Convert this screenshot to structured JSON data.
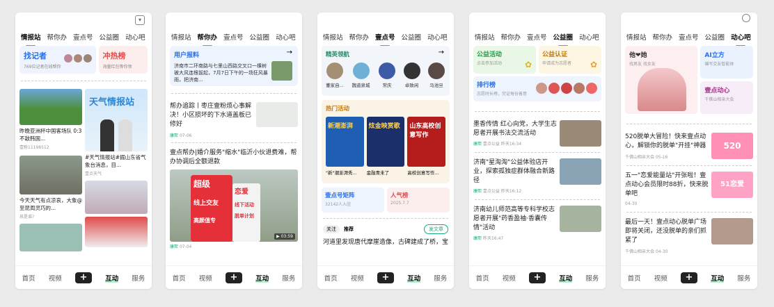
{
  "tabs": [
    "情报站",
    "帮你办",
    "壹点号",
    "公益圈",
    "动心吧"
  ],
  "nav": [
    "首页",
    "视频",
    "+",
    "互动",
    "服务"
  ],
  "s1": {
    "chip1": {
      "title": "找记者",
      "sub": "769位记者在线帮你"
    },
    "chip2": {
      "title": "冲热榜",
      "sub": "海量红包等你领"
    },
    "card1": {
      "title": "昨晚亚洲杯中国客场队 0:3不敌韩国...",
      "author": "壹粉11198512"
    },
    "card2": {
      "banner": "天气情报站",
      "title": "#天气情报站#掘山东省气象台消息，目...",
      "author": "壹点天气"
    },
    "card3": {
      "title": "今天天气有点凉哀，大象@至昆周灵巧的...",
      "author": "孩是谁?"
    }
  },
  "s2": {
    "report": {
      "label": "用户报料",
      "text": "济南市二环南路与七里山西路交叉口一棵树被大风连根拔起，7月7日下午的一场狂风暴雨，把济南..."
    },
    "a1": {
      "title": "帮办追踪丨枣庄壹粉烦心事解决！小区损坏的下水道盖板已修好",
      "source": "康熙",
      "date": "07-06"
    },
    "a2": {
      "title": "壹点帮办|婚介服务\"缩水\"临沂小伙退费难，帮办协调后全额退款",
      "source": "康熙",
      "date": "07-04"
    },
    "a2img": {
      "t1": "超级",
      "t2": "恋爱",
      "t3": "线上交友",
      "t4": "线下活动",
      "t5": "高颜值专",
      "t6": "脱单计划",
      "dur": "03:59"
    }
  },
  "s3": {
    "elite": "精英领航",
    "people": [
      "董家自...",
      "魏道泉城",
      "常庆",
      "卓致闲",
      "马池旦"
    ],
    "hot": "热门活动",
    "acts": [
      {
        "img": "新潮澎湃",
        "cap": "\"新\"潮澎湃秀..."
      },
      {
        "img": "炫金映赏歌",
        "cap": "金融青未了"
      },
      {
        "img": "山东高校创意写作",
        "cap": "高校创意写作..."
      }
    ],
    "matrix": "壹点号矩阵",
    "matrix_sub": "32142人入驻",
    "pop": "人气榜",
    "pop_date": "2025.7.7",
    "follow": "关注",
    "rec": "推荐",
    "post": "发文章",
    "tail": "河道里发现唐代摩崖造像，古碑建成了桥，宝"
  },
  "s4": {
    "c1": {
      "title": "公益活动",
      "sub": "点击参加活动"
    },
    "c2": {
      "title": "公益认证",
      "sub": "申请成为志愿者"
    },
    "rank": "排行榜",
    "rank_sub": "志愿时长榜，完证每份善意",
    "items": [
      {
        "title": "墨香传情 红心向党，大学生志愿者开展书法交流活动",
        "date": "昨天16:34"
      },
      {
        "title": "济南\"星淘淘\"公益体验店开业，探索孤独症群体融合新路径",
        "date": "昨天16:12"
      },
      {
        "title": "济南幼儿师范高等专科学校志愿者开展\"药香盈袖·香囊传情\"活动",
        "date": "昨天16:47"
      }
    ]
  },
  "s5": {
    "heart": {
      "title": "他❤她",
      "sub": "找男友 找女友"
    },
    "ai": {
      "title": "AI立方",
      "sub": "编写交友智能体"
    },
    "move": {
      "title": "壹点动心",
      "sub": "千佛山相亲大会"
    },
    "items": [
      {
        "title": "520脱单大冒险！快来壹点动心，解锁你的脱单\"开挂\"神器",
        "src": "千佛山相亲大会",
        "date": "05-16",
        "img": "520"
      },
      {
        "title": "五一\"恋爱能量站\"开张啦！壹点动心会员限时88折，快来脱单吧",
        "src": "",
        "date": "04-30",
        "img": "51恋爱"
      },
      {
        "title": "最后一天！壹点动心脱单广场即将关闭，还没脱单的亲们抓紧了",
        "src": "千佛山相亲大会",
        "date": "04-30",
        "img": ""
      }
    ]
  }
}
